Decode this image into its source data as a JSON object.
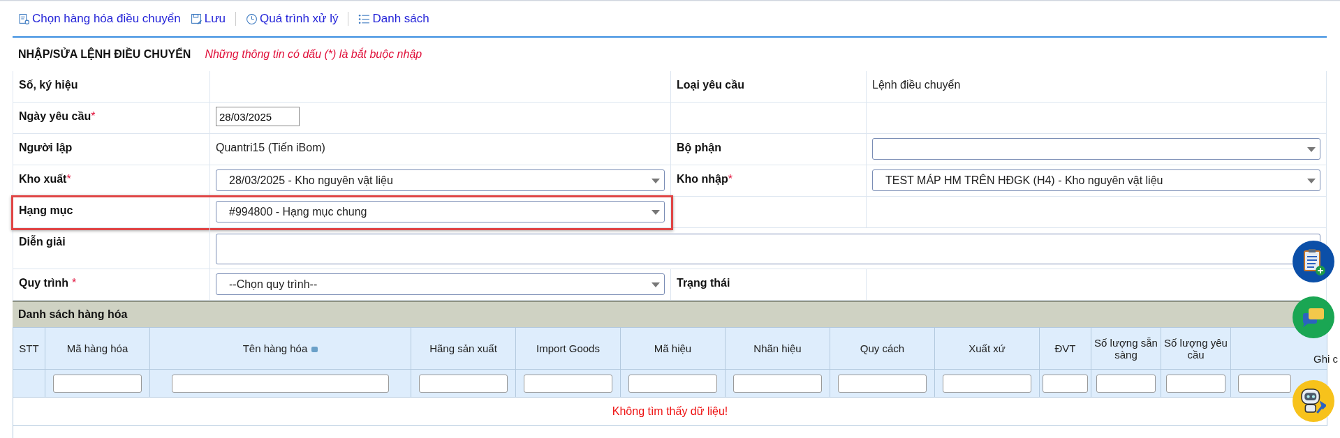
{
  "toolbar": [
    {
      "label": "Chọn hàng hóa điều chuyển"
    },
    {
      "label": "Lưu"
    },
    {
      "label": "Quá trình xử lý"
    },
    {
      "label": "Danh sách"
    }
  ],
  "form": {
    "title": "NHẬP/SỬA LỆNH ĐIỀU CHUYỂN",
    "note": "Những thông tin có dấu (*) là bắt buộc nhập",
    "rows": [
      {
        "highlighted": false,
        "left": {
          "label": "Số, ký hiệu",
          "field": {
            "kind": "text"
          }
        },
        "right": {
          "label": "Loại yêu cầu",
          "field": {
            "kind": "text",
            "value": "Lệnh điều chuyển"
          }
        }
      },
      {
        "highlighted": false,
        "left": {
          "label": "Ngày yêu cầu",
          "required_mark": "*",
          "spaced_mark": false,
          "field": {
            "kind": "date",
            "value": "28/03/2025"
          }
        },
        "right": {
          "field": {
            "kind": "text"
          }
        }
      },
      {
        "highlighted": false,
        "left": {
          "label": "Người lập",
          "field": {
            "kind": "text",
            "value": "Quantri15 (Tiến iBom)"
          }
        },
        "right": {
          "label": "Bộ phận",
          "field": {
            "kind": "select"
          }
        }
      },
      {
        "highlighted": false,
        "left": {
          "label": "Kho xuất",
          "required_mark": "*",
          "spaced_mark": false,
          "field": {
            "kind": "select",
            "value": "28/03/2025 - Kho nguyên vật liệu"
          }
        },
        "right": {
          "label": "Kho nhập",
          "required_mark": "*",
          "spaced_mark": false,
          "field": {
            "kind": "select",
            "value": "TEST MÁP HM TRÊN HĐGK (H4) - Kho nguyên vật liệu"
          }
        }
      },
      {
        "highlighted": true,
        "left": {
          "label": "Hạng mục",
          "field": {
            "kind": "select",
            "value": "#994800 - Hạng mục chung"
          }
        },
        "right": {
          "field": {
            "kind": "text"
          }
        }
      },
      {
        "highlighted": false,
        "left": {
          "label": "Diễn giải",
          "field": {
            "kind": "textarea"
          }
        }
      },
      {
        "highlighted": false,
        "left": {
          "label": "Quy trình",
          "required_mark": "*",
          "spaced_mark": true,
          "field": {
            "kind": "select",
            "value": "--Chọn quy trình--"
          }
        },
        "right": {
          "label": "Trạng thái",
          "field": {
            "kind": "text"
          }
        }
      }
    ]
  },
  "goods": {
    "title": "Danh sách hàng hóa",
    "columns": [
      {
        "label": "STT",
        "filter": false,
        "menu_icon": false
      },
      {
        "label": "Mã hàng hóa",
        "filter": true,
        "menu_icon": false
      },
      {
        "label": "Tên hàng hóa",
        "filter": true,
        "menu_icon": true
      },
      {
        "label": "Hãng sản xuất",
        "filter": true,
        "menu_icon": false
      },
      {
        "label": "Import Goods",
        "filter": true,
        "menu_icon": false
      },
      {
        "label": "Mã hiệu",
        "filter": true,
        "menu_icon": false
      },
      {
        "label": "Nhãn hiệu",
        "filter": true,
        "menu_icon": false
      },
      {
        "label": "Quy cách",
        "filter": true,
        "menu_icon": false
      },
      {
        "label": "Xuất xứ",
        "filter": true,
        "menu_icon": false
      },
      {
        "label": "ĐVT",
        "filter": true,
        "menu_icon": false
      },
      {
        "label": "Số lượng sẵn sàng",
        "filter": true,
        "menu_icon": false
      },
      {
        "label": "Số lượng yêu cầu",
        "filter": true,
        "menu_icon": false
      },
      {
        "label": "Ghi c",
        "filter": true,
        "menu_icon": false
      }
    ],
    "empty_message": "Không tìm thấy dữ liệu!"
  }
}
